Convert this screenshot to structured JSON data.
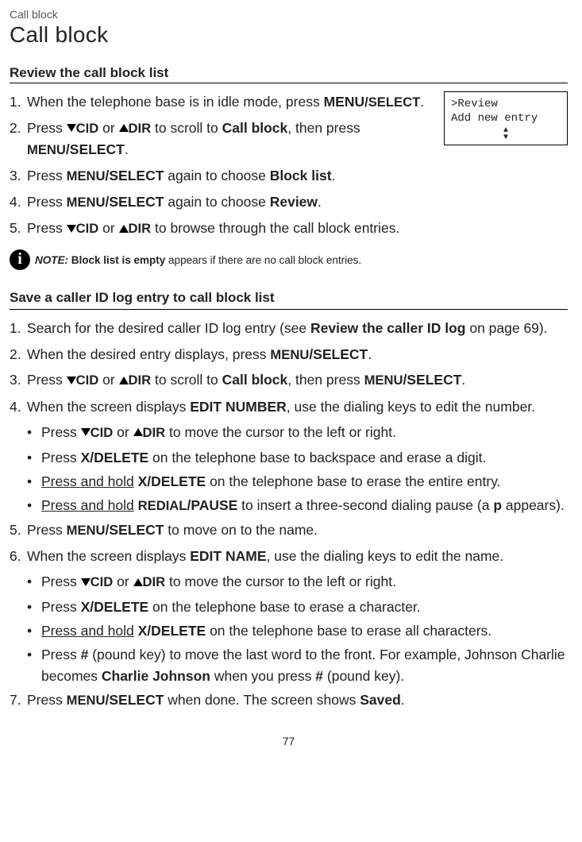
{
  "breadcrumb": "Call block",
  "pageTitle": "Call block",
  "lcd": {
    "line1": ">Review",
    "line2": " Add new entry"
  },
  "section1": {
    "title": "Review the call block list",
    "s1a": "When the telephone base is in idle mode, press ",
    "s1b": "MENU",
    "s1c": "/SELECT",
    "s1d": ".",
    "s2a": "Press ",
    "cid": "CID",
    "or": " or ",
    "dir": "DIR",
    "s2b": " to scroll to ",
    "s2c": "Call block",
    "s2d": ", then press ",
    "menu": "MENU",
    "select": "/SELECT",
    "period": ".",
    "s3a": " again to choose ",
    "s3b": "Block list",
    "s4b": "Review",
    "s5a": " to browse through the call block entries."
  },
  "note1a": "NOTE:",
  "note1b": " Block list is empty ",
  "note1c": "appears if there are no call block entries.",
  "section2": {
    "title": "Save a caller ID log entry to call block list",
    "s1a": "Search for the desired caller ID log entry (see ",
    "s1b": "Review the caller ID log",
    "s1c": " on page 69).",
    "s2a": "When the desired entry displays, press ",
    "s4a": "When the screen displays ",
    "s4b": "EDIT NUMBER",
    "s4c": ", use the dialing keys to edit the number.",
    "b1a": " to move the cursor to the left or right.",
    "b2a": "X/DELETE",
    "b2b": " on the telephone base to backspace and erase a digit.",
    "ph": "Press and hold",
    "b3b": " on the telephone base to erase the entire entry.",
    "b4a": "REDIAL",
    "b4b": "/PAUSE",
    "b4c": " to insert a three-second dialing pause (a ",
    "b4d": "p",
    "b4e": " appears).",
    "s5a": " to move on to the name.",
    "s6b": "EDIT NAME",
    "s6c": ", use the dialing keys to edit the name.",
    "b6b": " on the telephone base to erase a character.",
    "b7b": " on the telephone base to erase all characters.",
    "b8a": "# ",
    "b8b": "(pound key) to move the last word to the front. For example, Johnson Charlie becomes ",
    "b8c": "Charlie Johnson",
    "b8d": " when you press ",
    "b8e": "#",
    "b8f": " (pound key).",
    "s7a": " when done. The screen shows ",
    "s7b": "Saved"
  },
  "pageNumber": "77"
}
